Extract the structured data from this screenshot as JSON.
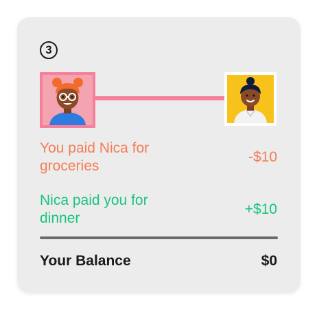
{
  "step": {
    "number": "3"
  },
  "people": {
    "left": {
      "avatar_icon": "person-avatar-icon",
      "accent": "#f4809a"
    },
    "right": {
      "avatar_icon": "person-avatar-icon",
      "accent": "#f7c31a"
    }
  },
  "transactions": [
    {
      "description": "You paid Nica for groceries",
      "amount": "-$10",
      "color": "#f47d55"
    },
    {
      "description": "Nica paid you for dinner",
      "amount": "+$10",
      "color": "#19c47f"
    }
  ],
  "balance": {
    "label": "Your Balance",
    "value": "$0"
  }
}
